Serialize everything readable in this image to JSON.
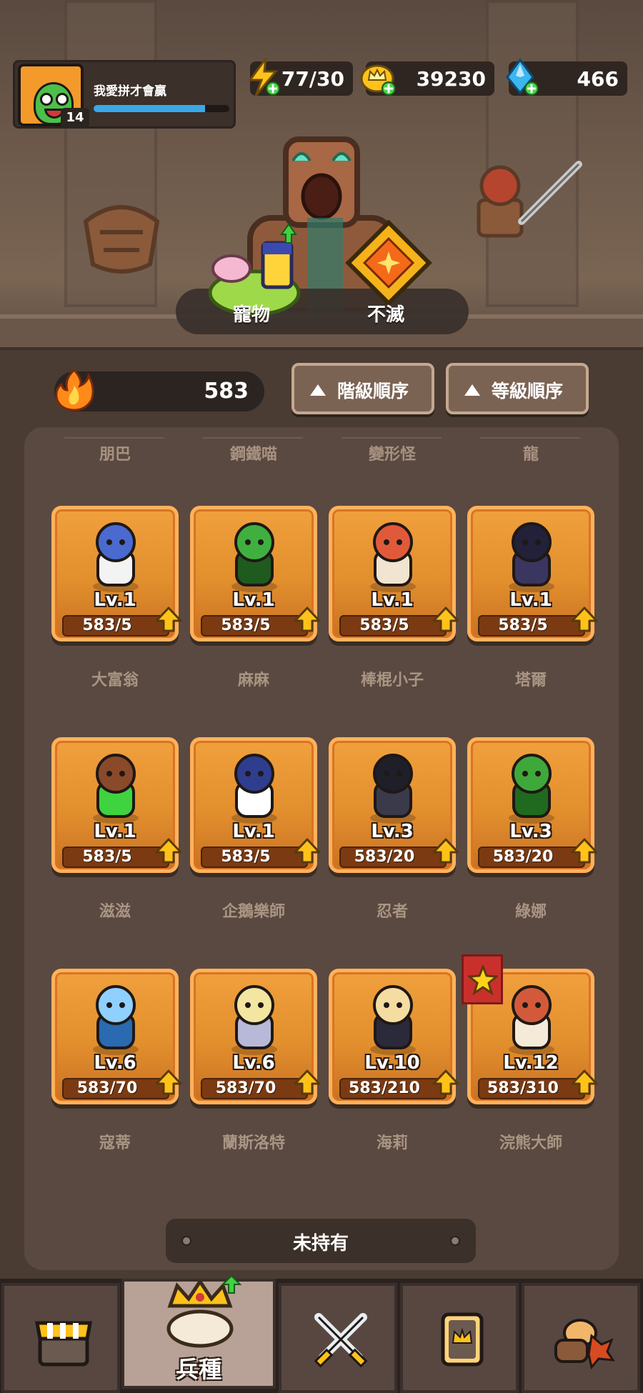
{
  "player": {
    "name": "我愛拼才會贏",
    "level": "14",
    "xp_fraction": 0.82
  },
  "resources": {
    "energy": "77/30",
    "coins": "39230",
    "gems": "466"
  },
  "hero_buttons": {
    "pet_label": "寵物",
    "immortal_label": "不滅"
  },
  "fire_count": "583",
  "sort": {
    "grade_label": "階級順序",
    "level_label": "等級順序"
  },
  "top_row_names": [
    "朋巴",
    "鋼鐵喵",
    "變形怪",
    "龍"
  ],
  "units": [
    {
      "name": "大富翁",
      "lv": "Lv.1",
      "progress": "583/5",
      "icon": "tophat-gentleman"
    },
    {
      "name": "麻麻",
      "lv": "Lv.1",
      "progress": "583/5",
      "icon": "cactus"
    },
    {
      "name": "棒棍小子",
      "lv": "Lv.1",
      "progress": "583/5",
      "icon": "bat-kid"
    },
    {
      "name": "塔爾",
      "lv": "Lv.1",
      "progress": "583/5",
      "icon": "shadow-blob"
    },
    {
      "name": "滋滋",
      "lv": "Lv.1",
      "progress": "583/5",
      "icon": "goblin-shaman"
    },
    {
      "name": "企鵝樂師",
      "lv": "Lv.1",
      "progress": "583/5",
      "icon": "penguin-musician"
    },
    {
      "name": "忍者",
      "lv": "Lv.3",
      "progress": "583/20",
      "icon": "ninja"
    },
    {
      "name": "綠娜",
      "lv": "Lv.3",
      "progress": "583/20",
      "icon": "dryad"
    },
    {
      "name": "寇蒂",
      "lv": "Lv.6",
      "progress": "583/70",
      "icon": "ice-mage"
    },
    {
      "name": "蘭斯洛特",
      "lv": "Lv.6",
      "progress": "583/70",
      "icon": "winged-knight"
    },
    {
      "name": "海莉",
      "lv": "Lv.10",
      "progress": "583/210",
      "icon": "blonde-hero"
    },
    {
      "name": "浣熊大師",
      "lv": "Lv.12",
      "progress": "583/310",
      "icon": "red-panda-master",
      "favorite": true
    }
  ],
  "unowned_label": "未持有",
  "nav": {
    "shop_icon": "shop-stall-icon",
    "units_label": "兵種",
    "battle_icon": "crossed-swords-icon",
    "cards_icon": "card-crown-icon",
    "items_icon": "bread-leaf-icon"
  },
  "colors": {
    "card_orange": "#e8952f",
    "xp_blue": "#3aa8e8",
    "upgrade_yellow": "#ffc21a",
    "background": "#4a3b33"
  }
}
